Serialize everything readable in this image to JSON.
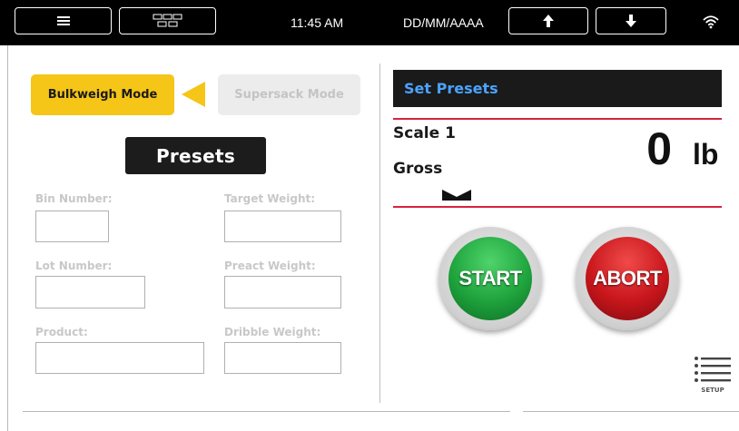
{
  "topbar": {
    "time": "11:45 AM",
    "date_format": "DD/MM/AAAA",
    "icons": [
      "menu-icon",
      "multi-scale-icon",
      "arrow-up-icon",
      "arrow-down-icon",
      "wifi-icon"
    ]
  },
  "modes": {
    "active_label": "Bulkweigh Mode",
    "inactive_label": "Supersack Mode"
  },
  "presets": {
    "title": "Presets",
    "fields": {
      "bin_number": {
        "label": "Bin Number:",
        "value": ""
      },
      "target_weight": {
        "label": "Target Weight:",
        "value": ""
      },
      "lot_number": {
        "label": "Lot Number:",
        "value": ""
      },
      "preact_weight": {
        "label": "Preact Weight:",
        "value": ""
      },
      "product": {
        "label": "Product:",
        "value": ""
      },
      "dribble_weight": {
        "label": "Dribble Weight:",
        "value": ""
      }
    }
  },
  "scale": {
    "header": "Set Presets",
    "name": "Scale 1",
    "mode": "Gross",
    "weight": "0",
    "unit": "lb"
  },
  "actions": {
    "start_label": "START",
    "abort_label": "ABORT",
    "setup_label": "SETUP"
  },
  "colors": {
    "accent_yellow": "#f5c518",
    "link_blue": "#4aa3ff",
    "divider_red": "#d9233d",
    "start_green": "#1fa33d",
    "abort_red": "#c8161c"
  }
}
